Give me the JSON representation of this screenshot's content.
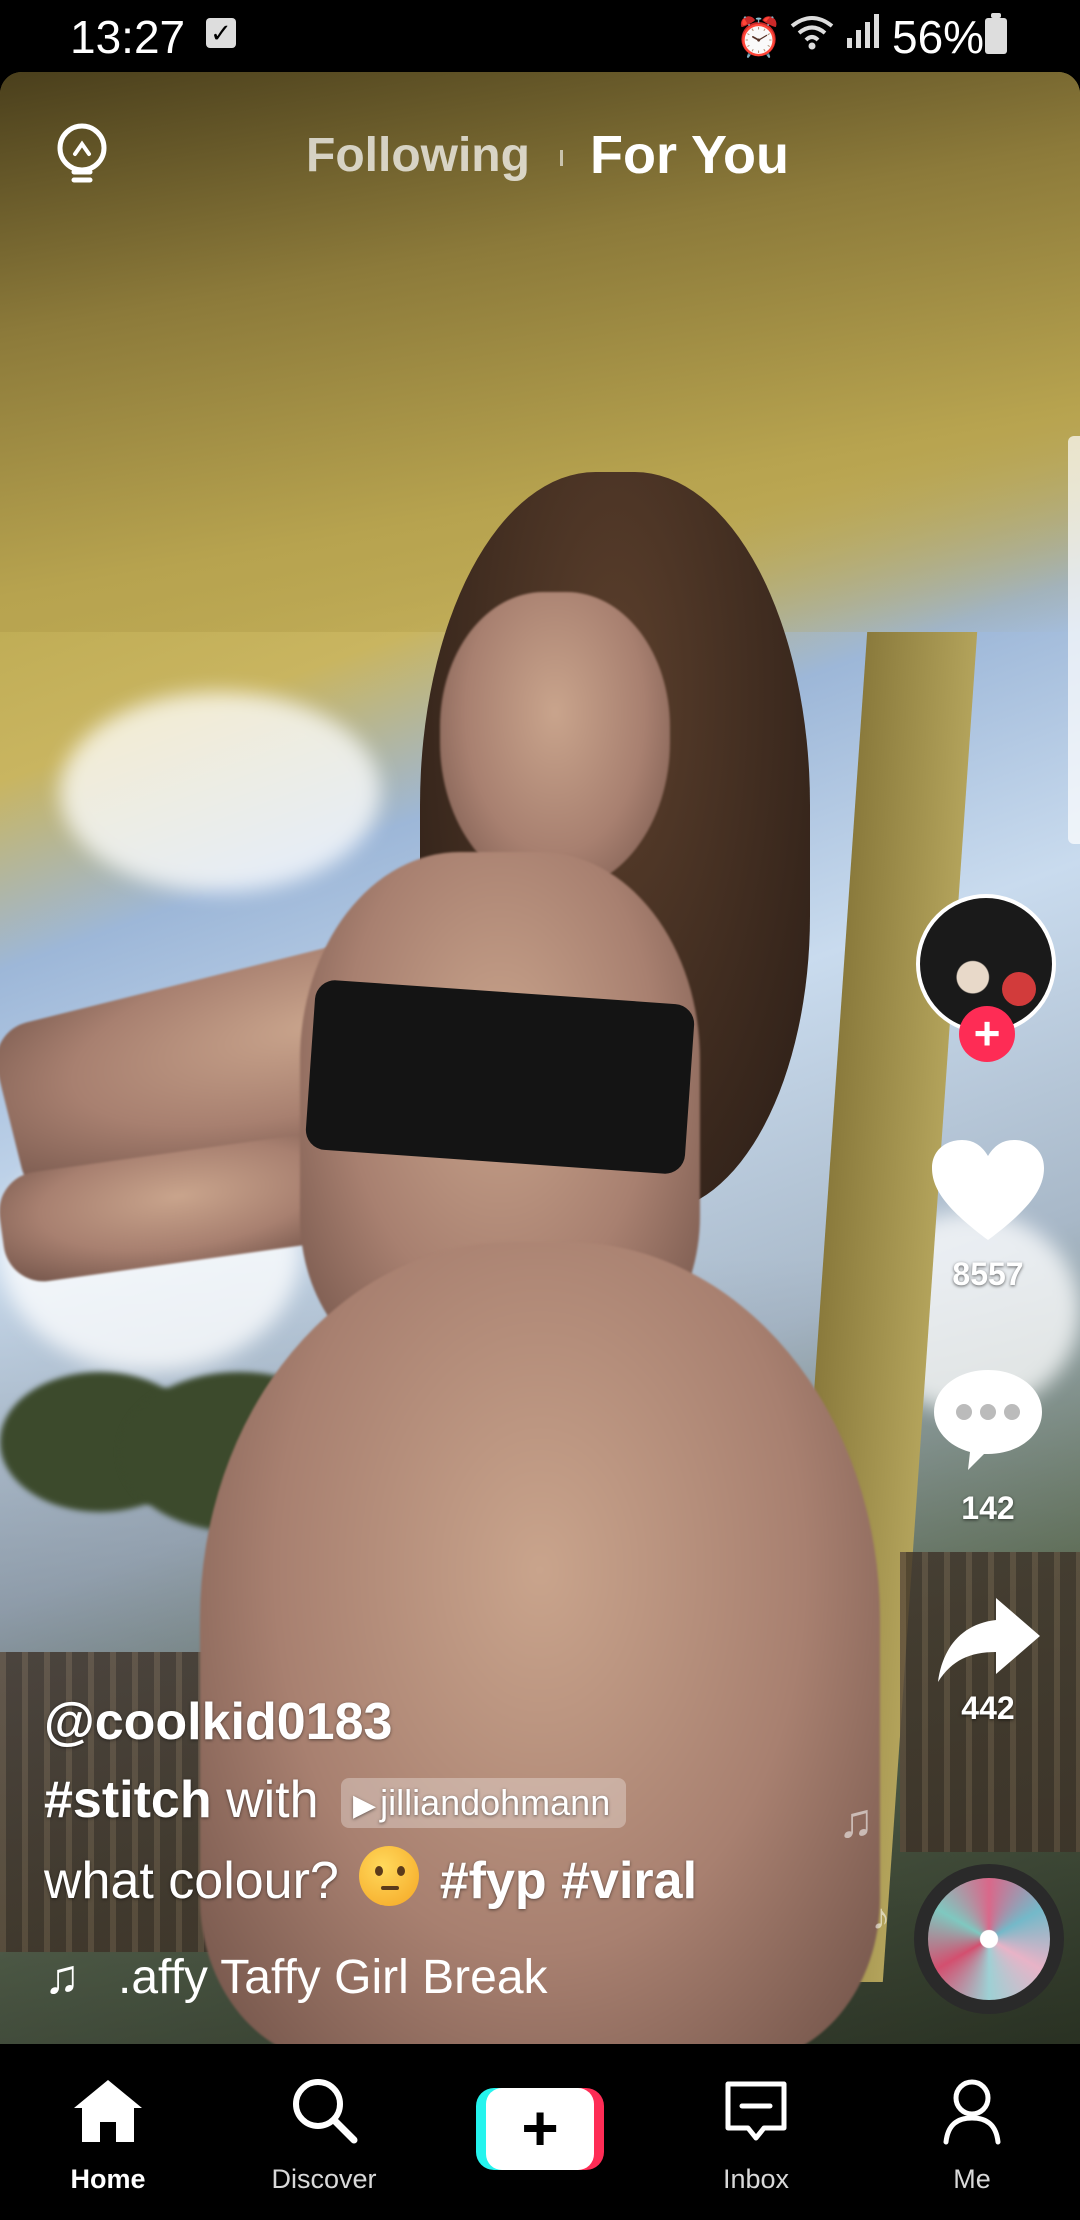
{
  "status_bar": {
    "time": "13:27",
    "battery_percent": "56%",
    "icons": [
      "checkbox-notification-icon",
      "alarm-icon",
      "wifi-icon",
      "signal-icon",
      "battery-icon"
    ]
  },
  "top_tabs": {
    "following": "Following",
    "for_you": "For You",
    "active": "For You"
  },
  "actions": {
    "likes": "8557",
    "comments": "142",
    "shares": "442"
  },
  "post": {
    "username": "@coolkid0183",
    "stitch_tag": "#stitch",
    "stitch_with": "with",
    "stitched_user": "jilliandohmann",
    "caption_text": "what colour?",
    "hashtag_1": "#fyp",
    "hashtag_2": "#viral",
    "sound": ".affy Taffy Girl Break"
  },
  "bottom_nav": {
    "home": "Home",
    "discover": "Discover",
    "inbox": "Inbox",
    "me": "Me",
    "active": "Home"
  },
  "colors": {
    "accent_red": "#fe2c55",
    "accent_cyan": "#25f4ee"
  }
}
